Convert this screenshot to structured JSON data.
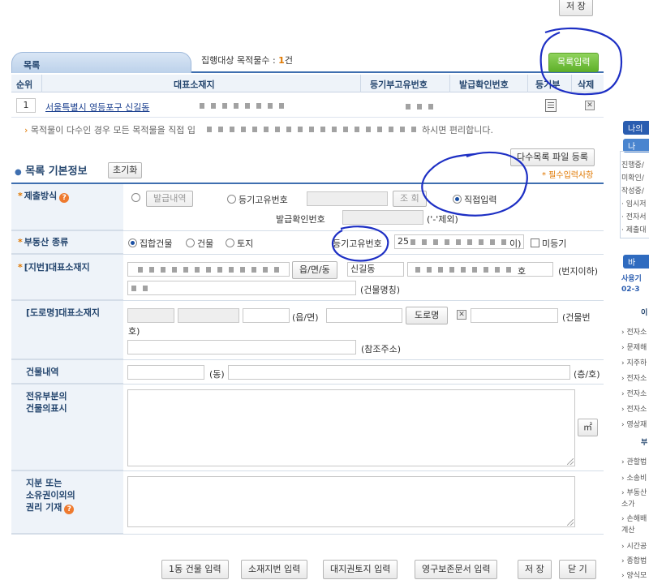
{
  "toolbar": {
    "save_top": "저 장"
  },
  "list": {
    "tab_label": "목록",
    "count_label": "집행대상 목적물수 :",
    "count_value": "1",
    "count_unit": "건",
    "add_button": "목록입력",
    "headers": [
      "순위",
      "대표소재지",
      "등기부고유번호",
      "발급확인번호",
      "등기부",
      "삭제"
    ],
    "row": {
      "rank": "1",
      "address": "서울특별시 영등포구 신길동 ",
      "unique_no": ""
    },
    "notice": "목적물이 다수인 경우 모든 목적물을 직접 입",
    "notice_end": "하시면 편리합니다."
  },
  "basic": {
    "title": "목록 기본정보",
    "reset_button": "초기화",
    "bulk_button": "다수목록 파일 등록",
    "required_note": "* 필수입력사항"
  },
  "form": {
    "submit_method": {
      "label": "제출방식",
      "opt1_button": "발급내역",
      "opt2": "등기고유번호",
      "lookup_button": "조 회",
      "opt3": "직접입력",
      "issue_label": "발급확인번호",
      "issue_hint": "('-'제외)"
    },
    "estate_type": {
      "label": "부동산 종류",
      "opt1": "집합건물",
      "opt2": "건물",
      "opt3": "토지",
      "unique_label": "등기고유번호",
      "unique_value": "25",
      "unique_suffix": "이)",
      "unregistered": "미등기"
    },
    "lot_address": {
      "label": "[지번]대표소재지",
      "town_button": "읍/면/동",
      "town_value": "신길동",
      "ho_suffix": "호",
      "lot_hint": "(번지이하)",
      "building_hint": "(건물명칭)"
    },
    "road_address": {
      "label": "[도로명]대표소재지",
      "town_hint": "(읍/면)",
      "road_button": "도로명",
      "building_no_hint": "(건물번",
      "building_no_hint2": "호)",
      "ref_hint": "(참조주소)"
    },
    "building": {
      "label": "건물내역",
      "dong_hint": "(동)",
      "floor_hint": "(층/호)"
    },
    "exclusive": {
      "label1": "전유부분의",
      "label2": "건물의표시",
      "unit_button": "㎡"
    },
    "rights": {
      "label1": "지분 또는",
      "label2": "소유권이외의",
      "label3": "권리 기재"
    }
  },
  "bottom_buttons": [
    "1동 건물 입력",
    "소재지번 입력",
    "대지권토지 입력",
    "영구보존문서 입력",
    "저 장",
    "닫 기"
  ],
  "sidebar": {
    "tab1": "나의",
    "tab2": "나",
    "lines": [
      "진행중/",
      "미확인/",
      "작성중/",
      "· 임시저",
      "· 전자서",
      "· 제출대"
    ],
    "tab3": "바",
    "sub1": "사용기",
    "sub2": "02-3",
    "section1": "이",
    "links1": [
      "› 전자소",
      "› 문제해",
      "› 지주하",
      "› 전자소",
      "› 전자소",
      "› 전자소",
      "› 영상재"
    ],
    "section2": "부",
    "links2": [
      "› 관할법",
      "› 소송비",
      "› 부동산",
      "  소가",
      "› 손해배",
      "  계산",
      "› 시간공",
      "› 종합법",
      "› 양식모"
    ]
  }
}
